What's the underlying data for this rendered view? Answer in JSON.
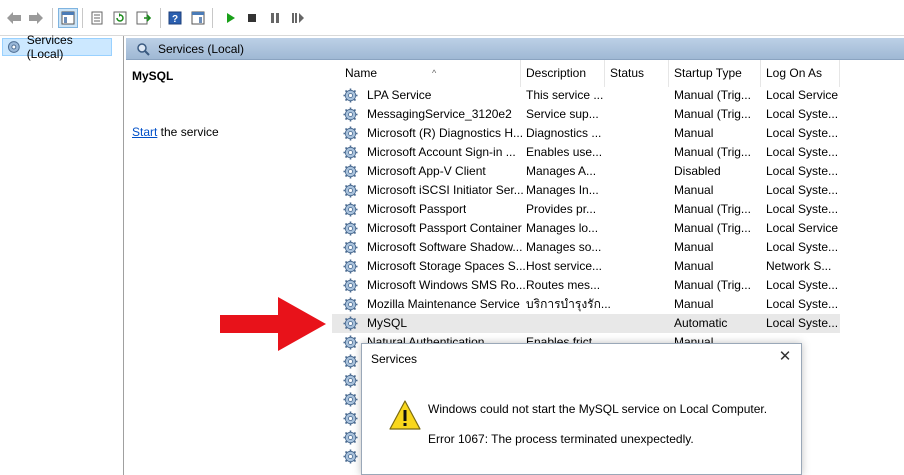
{
  "tree": {
    "item_label": "Services (Local)"
  },
  "header": {
    "title": "Services (Local)"
  },
  "description": {
    "service_name": "MySQL",
    "action_link": "Start",
    "action_rest": " the service"
  },
  "columns": [
    "Name",
    "Description",
    "Status",
    "Startup Type",
    "Log On As"
  ],
  "rows": [
    {
      "name": "LPA Service",
      "desc": "This service ...",
      "status": "",
      "startup": "Manual (Trig...",
      "logon": "Local Service"
    },
    {
      "name": "MessagingService_3120e2",
      "desc": "Service sup...",
      "status": "",
      "startup": "Manual (Trig...",
      "logon": "Local Syste..."
    },
    {
      "name": "Microsoft (R) Diagnostics H...",
      "desc": "Diagnostics ...",
      "status": "",
      "startup": "Manual",
      "logon": "Local Syste..."
    },
    {
      "name": "Microsoft Account Sign-in ...",
      "desc": "Enables use...",
      "status": "",
      "startup": "Manual (Trig...",
      "logon": "Local Syste..."
    },
    {
      "name": "Microsoft App-V Client",
      "desc": "Manages A...",
      "status": "",
      "startup": "Disabled",
      "logon": "Local Syste..."
    },
    {
      "name": "Microsoft iSCSI Initiator Ser...",
      "desc": "Manages In...",
      "status": "",
      "startup": "Manual",
      "logon": "Local Syste..."
    },
    {
      "name": "Microsoft Passport",
      "desc": "Provides pr...",
      "status": "",
      "startup": "Manual (Trig...",
      "logon": "Local Syste..."
    },
    {
      "name": "Microsoft Passport Container",
      "desc": "Manages lo...",
      "status": "",
      "startup": "Manual (Trig...",
      "logon": "Local Service"
    },
    {
      "name": "Microsoft Software Shadow...",
      "desc": "Manages so...",
      "status": "",
      "startup": "Manual",
      "logon": "Local Syste..."
    },
    {
      "name": "Microsoft Storage Spaces S...",
      "desc": "Host service...",
      "status": "",
      "startup": "Manual",
      "logon": "Network S..."
    },
    {
      "name": "Microsoft Windows SMS Ro...",
      "desc": "Routes mes...",
      "status": "",
      "startup": "Manual (Trig...",
      "logon": "Local Syste..."
    },
    {
      "name": "Mozilla Maintenance Service",
      "desc": "บริการบำรุงรัก...",
      "status": "",
      "startup": "Manual",
      "logon": "Local Syste..."
    },
    {
      "name": "MySQL",
      "desc": "",
      "status": "",
      "startup": "Automatic",
      "logon": "Local Syste..."
    },
    {
      "name": "Natural Authentication",
      "desc": "Enables frict...",
      "status": "",
      "startup": "Manual",
      "logon": ""
    },
    {
      "name": "",
      "desc": "",
      "status": "",
      "startup": "",
      "logon": "ervice"
    },
    {
      "name": "",
      "desc": "",
      "status": "",
      "startup": "",
      "logon": "yste..."
    },
    {
      "name": "",
      "desc": "",
      "status": "",
      "startup": "",
      "logon": "ervice"
    },
    {
      "name": "",
      "desc": "",
      "status": "",
      "startup": "",
      "logon": "yste..."
    },
    {
      "name": "",
      "desc": "",
      "status": "",
      "startup": "",
      "logon": "yste..."
    },
    {
      "name": "",
      "desc": "",
      "status": "",
      "startup": "",
      "logon": "yste..."
    }
  ],
  "selected_row": 12,
  "dialog": {
    "title": "Services",
    "close": "✕",
    "message": "Windows could not start the MySQL service on Local Computer.",
    "error": "Error 1067: The process terminated unexpectedly."
  },
  "icons": {
    "toolbar": [
      "back-icon",
      "forward-icon",
      "show-hide-console-tree-icon",
      "properties-icon",
      "refresh-icon",
      "export-list-icon",
      "help-icon",
      "show-action-pane-icon",
      "start-icon",
      "stop-icon",
      "pause-icon",
      "resume-icon"
    ]
  },
  "colors": {
    "header_blue": "#9fb8d4",
    "arrow_red": "#e8121a",
    "link": "#0050c8",
    "warn_yellow": "#f9d71c"
  }
}
